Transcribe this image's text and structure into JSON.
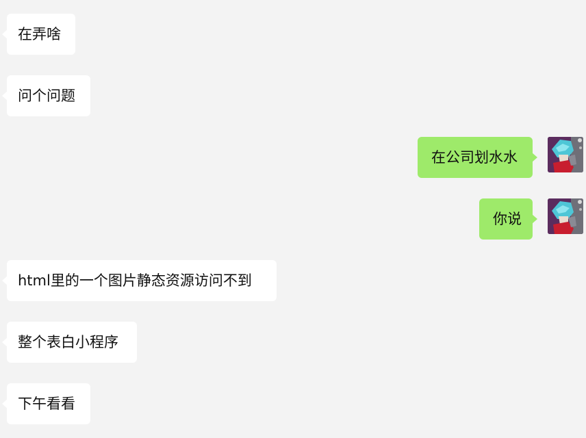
{
  "messages": [
    {
      "side": "in",
      "text": "在弄啥"
    },
    {
      "side": "in",
      "text": "问个问题"
    },
    {
      "side": "out",
      "text": "在公司划水水",
      "avatar": "user-avatar"
    },
    {
      "side": "out",
      "text": "你说",
      "avatar": "user-avatar"
    },
    {
      "side": "in",
      "text": "html里的一个图片静态资源访问不到"
    },
    {
      "side": "in",
      "text": "整个表白小程序"
    },
    {
      "side": "in",
      "text": "下午看看"
    }
  ],
  "colors": {
    "background": "#f3f3f3",
    "incoming_bubble": "#ffffff",
    "outgoing_bubble": "#9eea6a"
  }
}
